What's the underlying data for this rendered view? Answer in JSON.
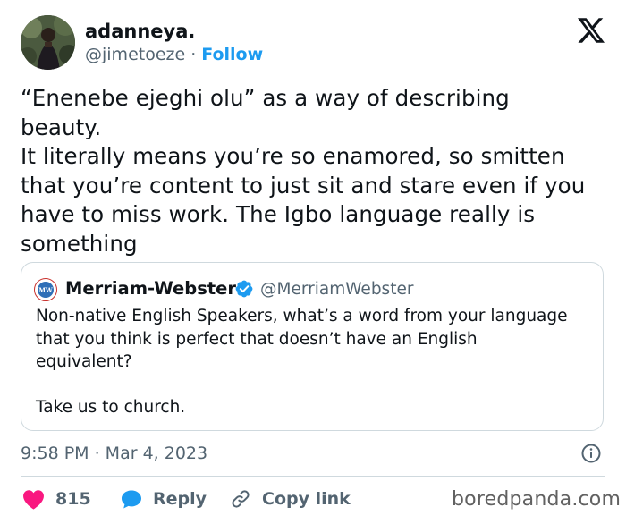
{
  "author": {
    "display_name": "adanneya.",
    "handle": "@jimetoeze",
    "separator": "·",
    "follow_label": "Follow"
  },
  "tweet": {
    "text": "“Enenebe ejeghi olu” as a way of describing\nbeauty.\nIt literally means you’re so enamored, so smitten\nthat you’re content to just sit and stare even if you\nhave to miss work. The Igbo language really is\nsomething",
    "timestamp": "9:58 PM · Mar 4, 2023"
  },
  "quote": {
    "display_name": "Merriam-Webster",
    "handle": "@MerriamWebster",
    "avatar_text": "MW",
    "text": "Non-native English Speakers, what’s a word from your language\nthat you think is perfect that doesn’t have an English\nequivalent?\n\nTake us to church."
  },
  "actions": {
    "like_count": "815",
    "reply_label": "Reply",
    "copy_link_label": "Copy link"
  },
  "watermark": "boredpanda.com",
  "colors": {
    "accent": "#1d9bf0",
    "like": "#f91880",
    "muted": "#536471",
    "border": "#cfd9de"
  },
  "icons": {
    "brand": "x-logo-icon",
    "verified": "verified-badge-icon",
    "info": "info-icon",
    "like": "heart-icon",
    "reply": "speech-bubble-icon",
    "copy_link": "link-icon"
  }
}
